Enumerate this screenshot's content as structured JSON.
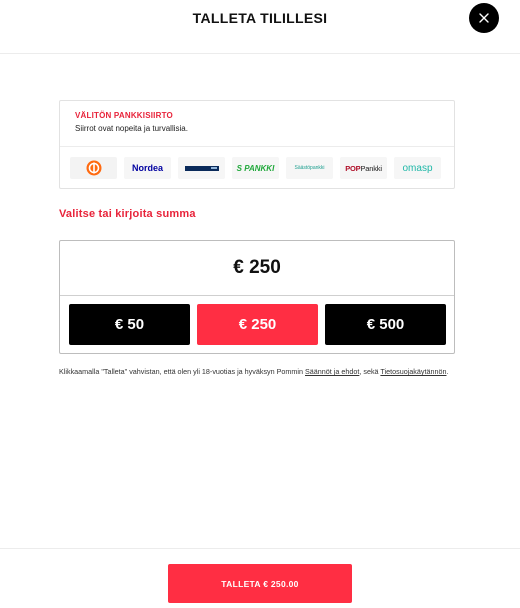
{
  "header": {
    "title": "TALLETA TILILLESI",
    "close_icon": "close-icon"
  },
  "bank": {
    "title": "VÄLITÖN PANKKISIIRTO",
    "subtitle": "Siirrot ovat nopeita ja turvallisia.",
    "logos": [
      {
        "name": "op-logo",
        "text": ""
      },
      {
        "name": "nordea-logo",
        "text": "Nordea"
      },
      {
        "name": "danske-logo",
        "text": ""
      },
      {
        "name": "s-pankki-logo",
        "text": "S PANKKI"
      },
      {
        "name": "saastopankki-logo",
        "text": "Säästöpankki"
      },
      {
        "name": "pop-pankki-logo",
        "text_pop": "POP",
        "text_pankki": "Pankki"
      },
      {
        "name": "omasp-logo",
        "text": "omasp"
      }
    ]
  },
  "amount": {
    "label": "Valitse tai kirjoita summa",
    "value": "€ 250",
    "presets": [
      {
        "label": "€ 50",
        "selected": false
      },
      {
        "label": "€ 250",
        "selected": true
      },
      {
        "label": "€ 500",
        "selected": false
      }
    ]
  },
  "terms": {
    "prefix": "Klikkaamalla \"Talleta\" vahvistan, että olen yli 18-vuotias ja hyväksyn Pommin ",
    "rules_link": "Säännöt ja ehdot",
    "middle": ", sekä ",
    "privacy_link": "Tietosuojakäytännön",
    "suffix": "."
  },
  "footer": {
    "submit_label": "TALLETA € 250.00"
  },
  "colors": {
    "accent": "#ff2e43",
    "label_red": "#e8233a",
    "dark": "#000000"
  }
}
